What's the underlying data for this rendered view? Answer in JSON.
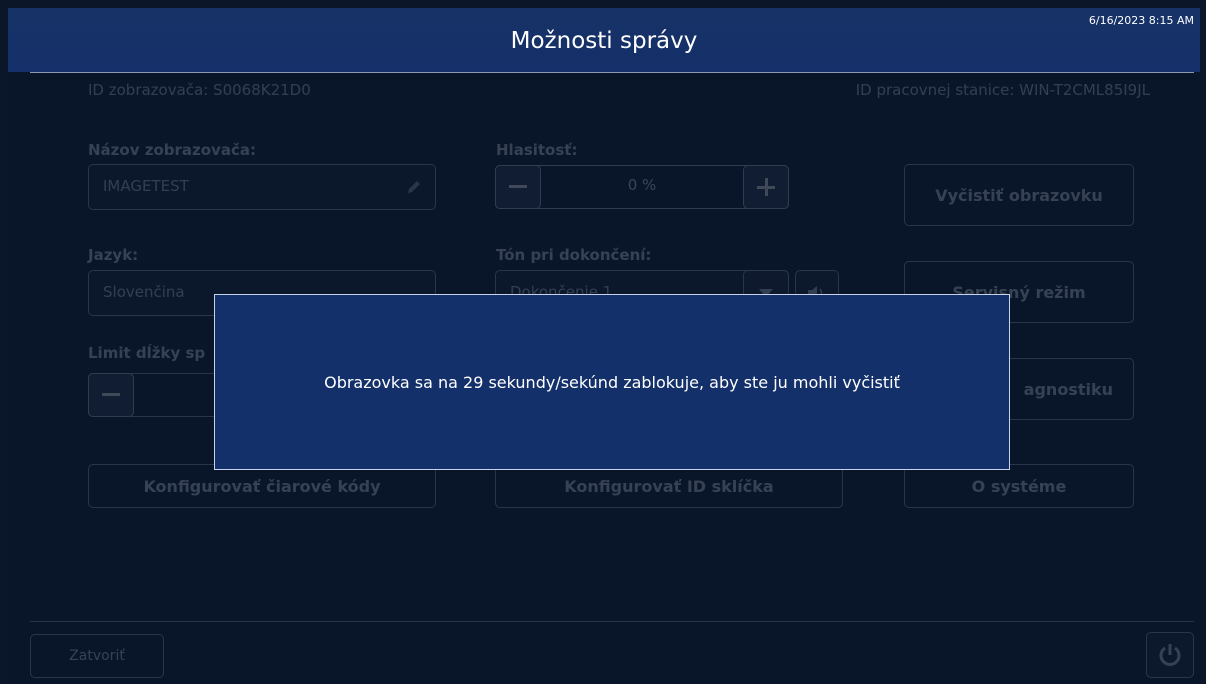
{
  "header": {
    "title": "Možnosti správy",
    "clock": "6/16/2023 8:15 AM"
  },
  "meta": {
    "viewer_id": "ID zobrazovača: S0068K21D0",
    "workstation_id": "ID pracovnej stanice: WIN-T2CML85I9JL"
  },
  "viewer_name": {
    "label": "Názov zobrazovača:",
    "value": "IMAGETEST"
  },
  "volume": {
    "label": "Hlasitosť:",
    "value": "0 %"
  },
  "language": {
    "label": "Jazyk:",
    "value": "Slovenčina"
  },
  "completion_tone": {
    "label": "Tón pri dokončení:",
    "value": "Dokončenie 1"
  },
  "length_limit": {
    "label": "Limit dĺžky sp"
  },
  "buttons": {
    "clear_screen": "Vyčistiť obrazovku",
    "service_mode": "Servisný režim",
    "diagnostics": "agnostiku",
    "configure_barcodes": "Konfigurovať čiarové kódy",
    "configure_slide_id": "Konfigurovať ID sklíčka",
    "about": "O systéme",
    "close": "Zatvoriť"
  },
  "modal": {
    "message": "Obrazovka sa na 29 sekundy/sekúnd zablokuje, aby ste ju mohli vyčistiť"
  }
}
